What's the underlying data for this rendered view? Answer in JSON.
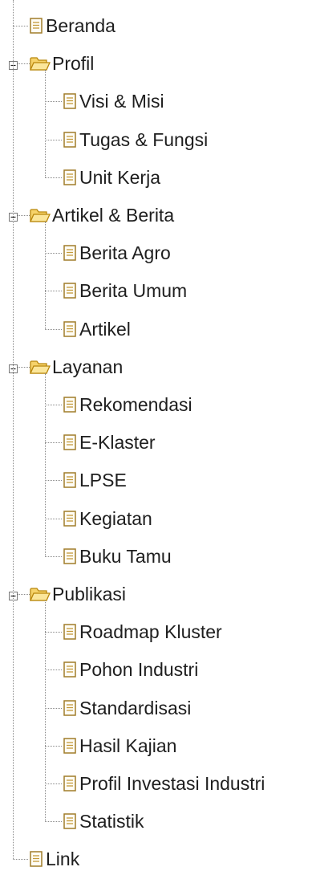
{
  "tree": {
    "items": [
      {
        "label": "Beranda",
        "kind": "file",
        "icon": "document-icon"
      },
      {
        "label": "Profil",
        "kind": "folder",
        "icon": "folder-open-icon",
        "expanded": true,
        "children": [
          {
            "label": "Visi & Misi",
            "icon": "document-icon"
          },
          {
            "label": "Tugas & Fungsi",
            "icon": "document-icon"
          },
          {
            "label": "Unit Kerja",
            "icon": "document-icon"
          }
        ]
      },
      {
        "label": "Artikel & Berita",
        "kind": "folder",
        "icon": "folder-open-icon",
        "expanded": true,
        "children": [
          {
            "label": "Berita Agro",
            "icon": "document-icon"
          },
          {
            "label": "Berita Umum",
            "icon": "document-icon"
          },
          {
            "label": "Artikel",
            "icon": "document-icon"
          }
        ]
      },
      {
        "label": "Layanan",
        "kind": "folder",
        "icon": "folder-open-icon",
        "expanded": true,
        "children": [
          {
            "label": "Rekomendasi",
            "icon": "document-icon"
          },
          {
            "label": "E-Klaster",
            "icon": "document-icon"
          },
          {
            "label": "LPSE",
            "icon": "document-icon"
          },
          {
            "label": "Kegiatan",
            "icon": "document-icon"
          },
          {
            "label": "Buku Tamu",
            "icon": "document-icon"
          }
        ]
      },
      {
        "label": "Publikasi",
        "kind": "folder",
        "icon": "folder-open-icon",
        "expanded": true,
        "children": [
          {
            "label": "Roadmap Kluster",
            "icon": "document-icon"
          },
          {
            "label": "Pohon Industri",
            "icon": "document-icon"
          },
          {
            "label": "Standardisasi",
            "icon": "document-icon"
          },
          {
            "label": "Hasil Kajian",
            "icon": "document-icon"
          },
          {
            "label": "Profil Investasi Industri",
            "icon": "document-icon"
          },
          {
            "label": "Statistik",
            "icon": "document-icon"
          }
        ]
      },
      {
        "label": "Link",
        "kind": "file",
        "icon": "document-icon"
      }
    ]
  },
  "colors": {
    "connector": "#8a8a8a",
    "folder_fill": "#f6d36b",
    "folder_stroke": "#b8860b",
    "doc_stroke": "#a07d2a",
    "doc_lines": "#c49a3a"
  }
}
